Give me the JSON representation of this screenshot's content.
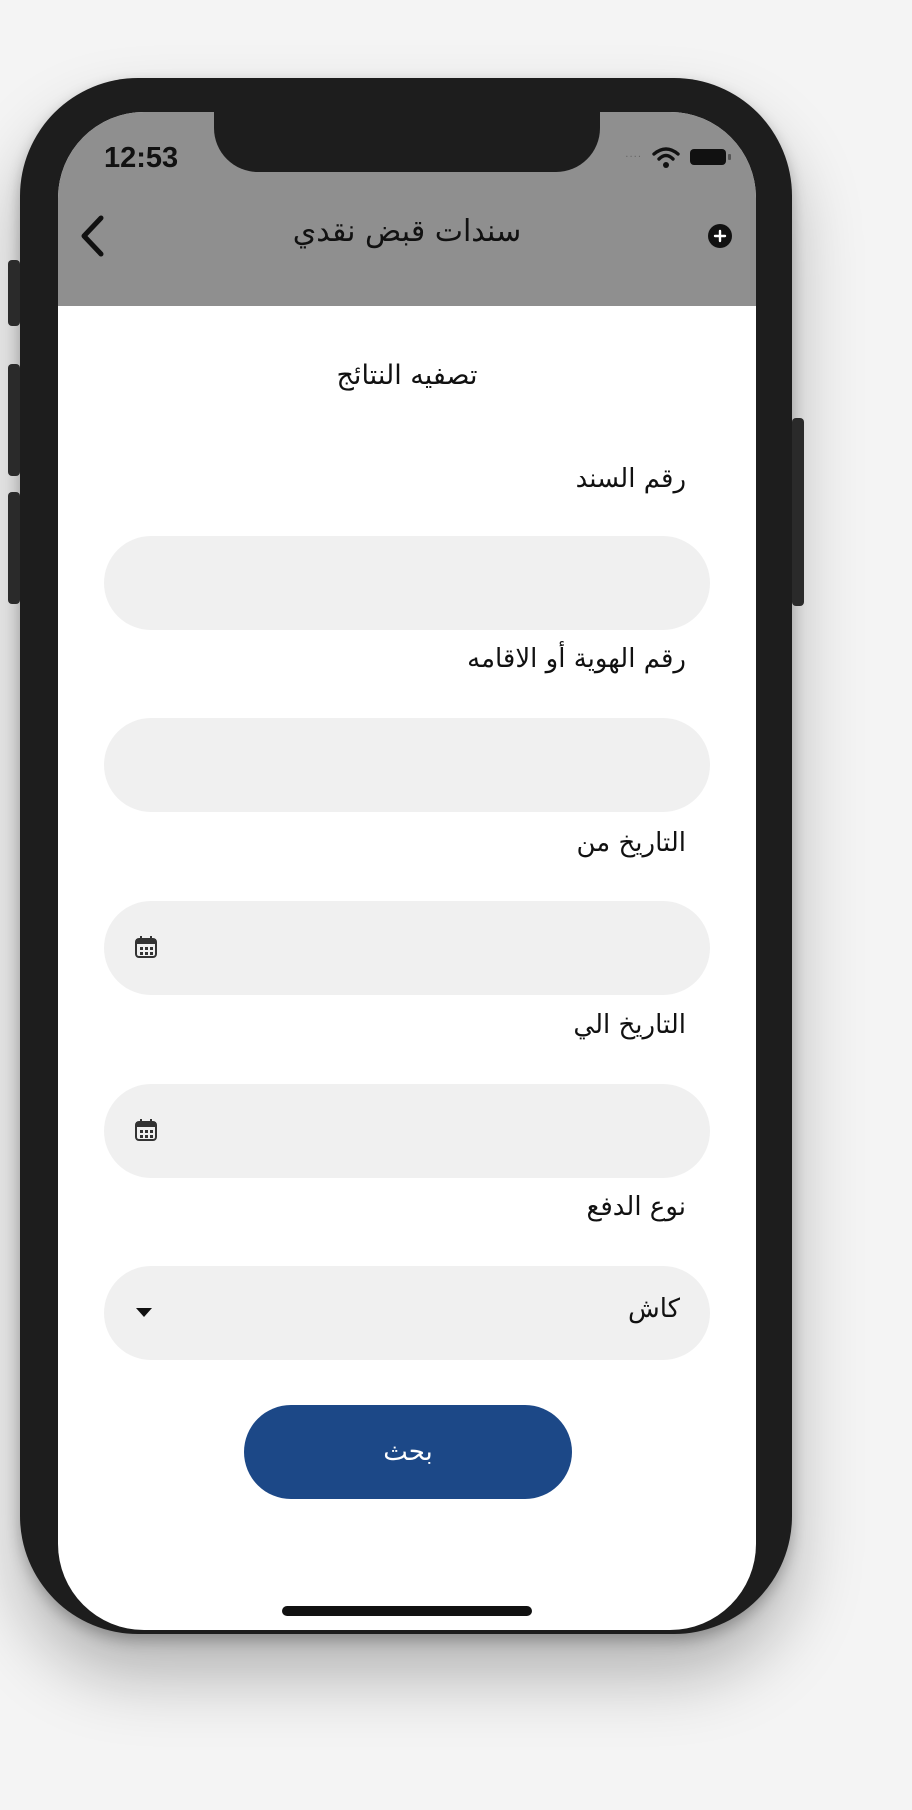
{
  "status_bar": {
    "time": "12:53",
    "signal_icon": "signal-dots-icon",
    "wifi_icon": "wifi-icon",
    "battery_icon": "battery-icon"
  },
  "nav": {
    "title": "سندات قبض نقدي",
    "back_icon": "chevron-left-icon",
    "add_icon": "add-circle-icon"
  },
  "filter": {
    "title": "تصفيه النتائج",
    "fields": {
      "voucher_number": {
        "label": "رقم السند",
        "value": ""
      },
      "id_number": {
        "label": "رقم الهوية أو الاقامه",
        "value": ""
      },
      "date_from": {
        "label": "التاريخ من",
        "value": "",
        "icon": "calendar-icon"
      },
      "date_to": {
        "label": "التاريخ الي",
        "value": "",
        "icon": "calendar-icon"
      },
      "payment_type": {
        "label": "نوع الدفع",
        "selected": "كاش",
        "icon": "dropdown-arrow-icon"
      }
    },
    "search_button": "بحث"
  },
  "colors": {
    "nav_bar": "#8f8f8f",
    "field_bg": "#f0f0f0",
    "primary_button": "#1c4887"
  }
}
